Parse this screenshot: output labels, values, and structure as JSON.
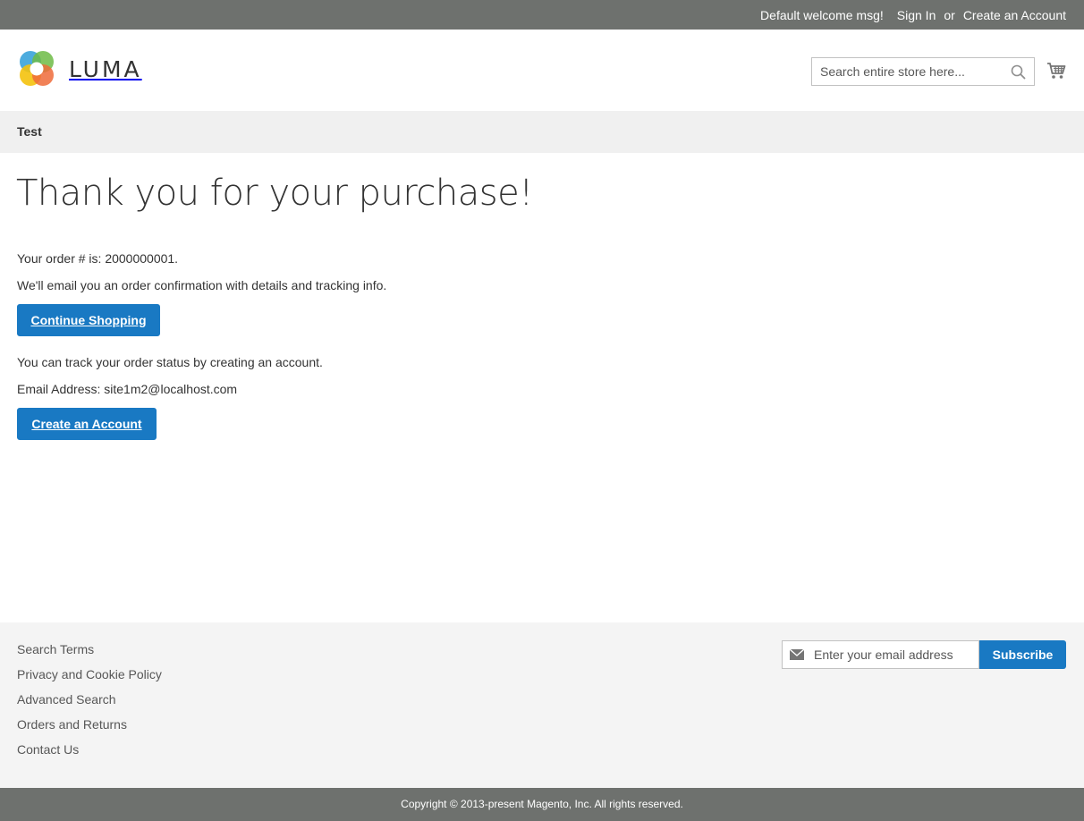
{
  "top_bar": {
    "welcome": "Default welcome msg!",
    "sign_in": "Sign In",
    "or": "or",
    "create_account": "Create an Account"
  },
  "header": {
    "logo_text": "LUMA",
    "search_placeholder": "Search entire store here...",
    "icons": {
      "search": "search-icon",
      "cart": "cart-icon"
    }
  },
  "breadcrumb": {
    "label": "Test"
  },
  "main": {
    "title": "Thank you for your purchase!",
    "order_line": "Your order # is: 2000000001.",
    "email_info": "We'll email you an order confirmation with details and tracking info.",
    "continue_button": "Continue Shopping",
    "track_info": "You can track your order status by creating an account.",
    "email_address": "Email Address: site1m2@localhost.com",
    "create_button": "Create an Account"
  },
  "footer": {
    "links": [
      "Search Terms",
      "Privacy and Cookie Policy",
      "Advanced Search",
      "Orders and Returns",
      "Contact Us"
    ],
    "newsletter_placeholder": "Enter your email address",
    "subscribe_button": "Subscribe",
    "copyright": "Copyright © 2013-present Magento, Inc. All rights reserved."
  },
  "colors": {
    "top_bar": "#6e716e",
    "accent_blue": "#1979c3",
    "breadcrumb_bg": "#f0f0f0",
    "footer_bg": "#f4f4f4"
  }
}
